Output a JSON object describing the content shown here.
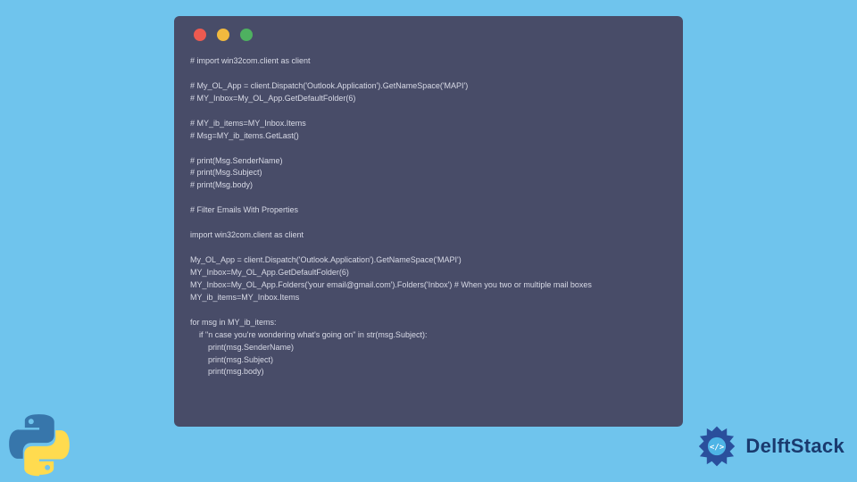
{
  "window": {
    "dots": [
      "red",
      "yellow",
      "green"
    ]
  },
  "code": {
    "lines": "# import win32com.client as client\n\n# My_OL_App = client.Dispatch('Outlook.Application').GetNameSpace('MAPI')\n# MY_Inbox=My_OL_App.GetDefaultFolder(6)\n\n# MY_ib_items=MY_Inbox.Items\n# Msg=MY_ib_items.GetLast()\n\n# print(Msg.SenderName)\n# print(Msg.Subject)\n# print(Msg.body)\n\n# Filter Emails With Properties\n\nimport win32com.client as client\n\nMy_OL_App = client.Dispatch('Outlook.Application').GetNameSpace('MAPI')\nMY_Inbox=My_OL_App.GetDefaultFolder(6)\nMY_Inbox=My_OL_App.Folders('your email@gmail.com').Folders('Inbox') # When you two or multiple mail boxes\nMY_ib_items=MY_Inbox.Items\n\nfor msg in MY_ib_items:\n    if \"n case you're wondering what's going on\" in str(msg.Subject):\n        print(msg.SenderName)\n        print(msg.Subject)\n        print(msg.body)"
  },
  "logo": {
    "python_name": "python-logo",
    "delft_text": "DelftStack"
  }
}
